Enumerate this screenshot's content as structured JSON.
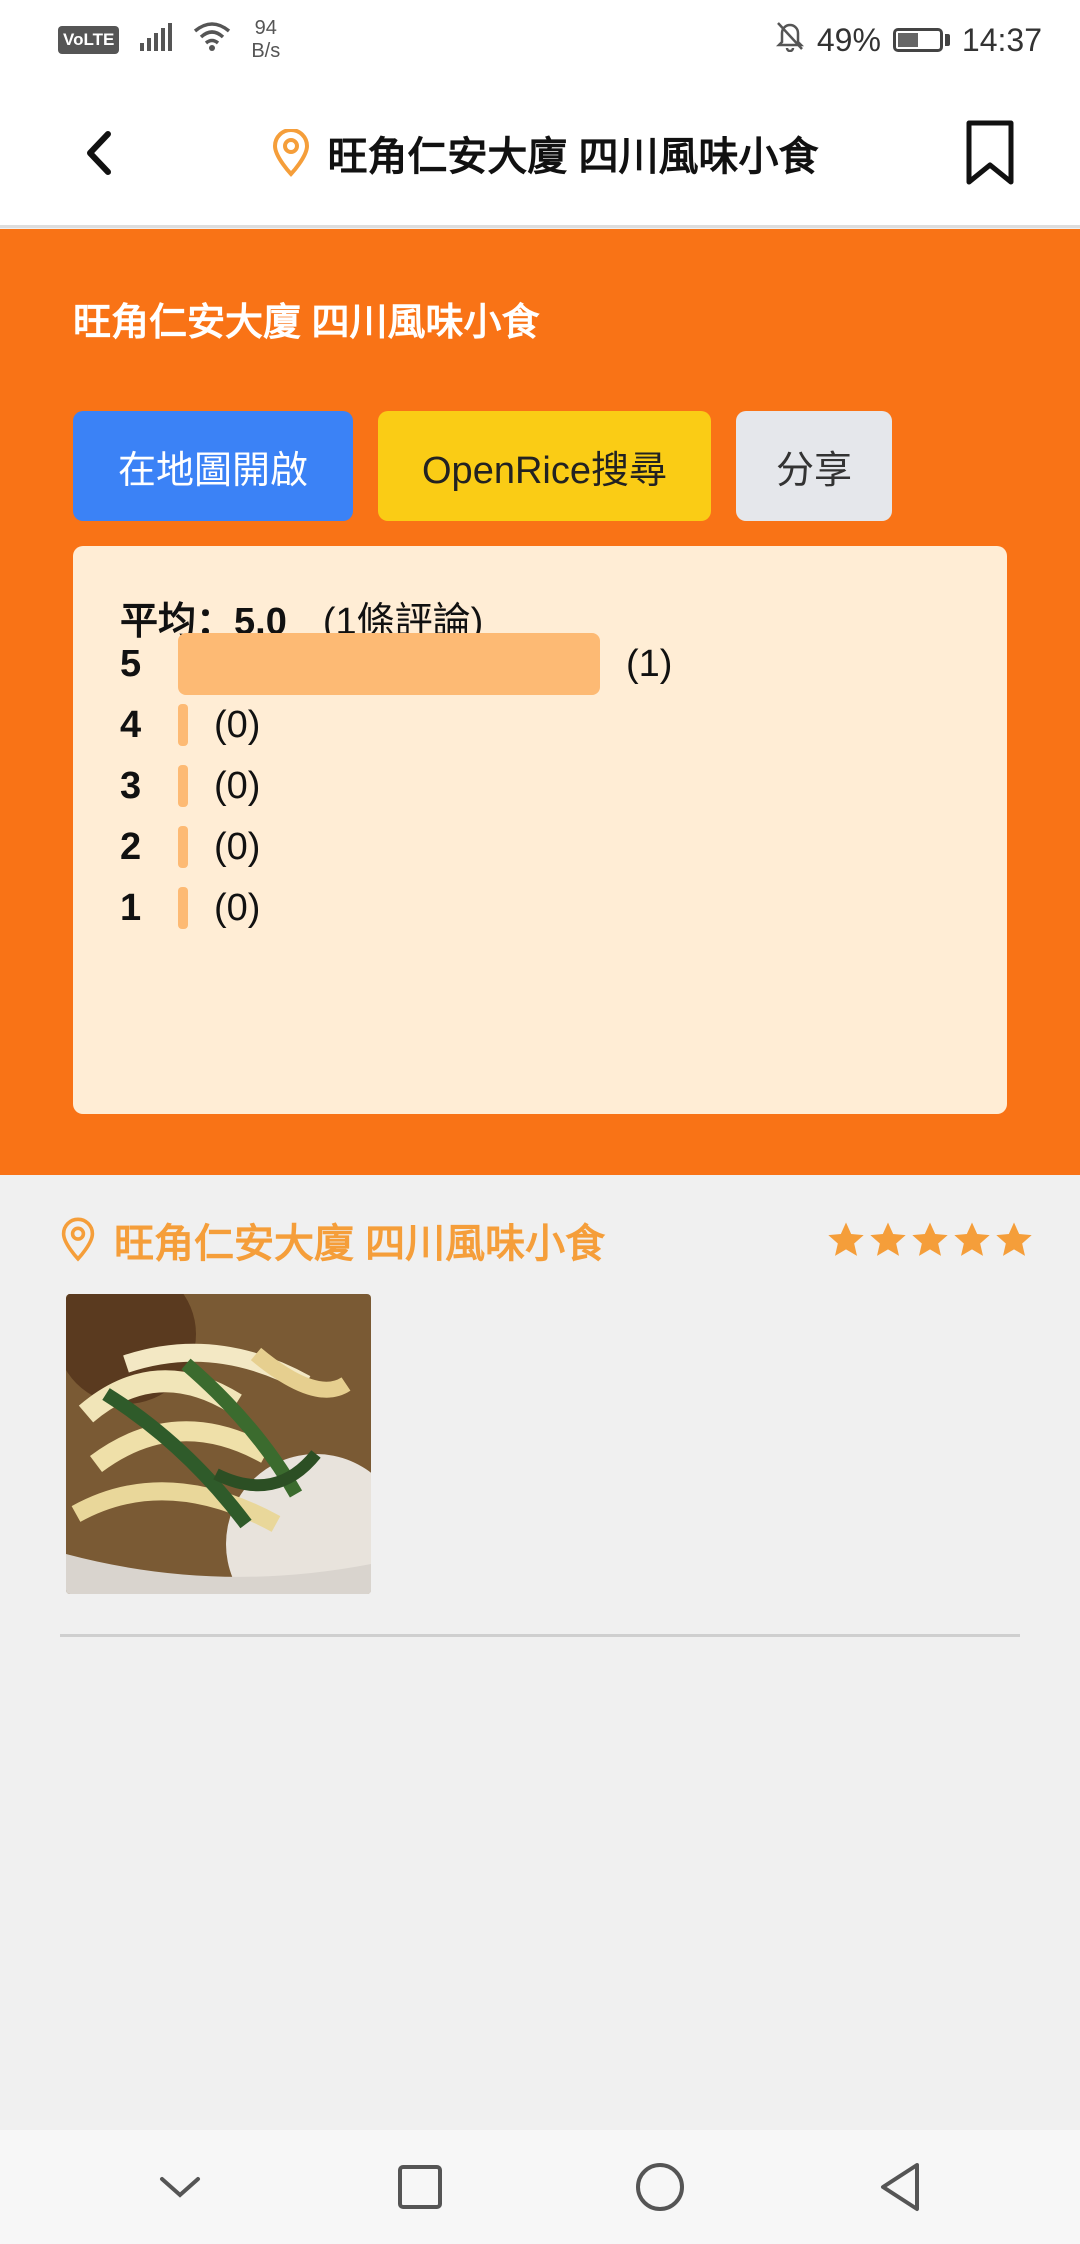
{
  "status_bar": {
    "volte": "VoLTE",
    "net_speed_value": "94",
    "net_speed_unit": "B/s",
    "battery": "49%",
    "time": "14:37"
  },
  "app_bar": {
    "title": "旺角仁安大廈 四川風味小食"
  },
  "header": {
    "place_name": "旺角仁安大廈 四川風味小食",
    "buttons": {
      "map": "在地圖開啟",
      "openrice": "OpenRice搜尋",
      "share": "分享"
    },
    "ratings": {
      "average_label": "平均：5.0",
      "review_count": "(1條評論)",
      "rows": [
        {
          "level": "5",
          "count": "(1)",
          "fraction": 1.0
        },
        {
          "level": "4",
          "count": "(0)",
          "fraction": 0
        },
        {
          "level": "3",
          "count": "(0)",
          "fraction": 0
        },
        {
          "level": "2",
          "count": "(0)",
          "fraction": 0
        },
        {
          "level": "1",
          "count": "(0)",
          "fraction": 0
        }
      ]
    }
  },
  "reviews": [
    {
      "place_name": "旺角仁安大廈 四川風味小食",
      "stars": 5
    }
  ],
  "colors": {
    "brand_orange": "#f97316",
    "map_button": "#3b82f6",
    "openrice_button": "#facc15",
    "share_button": "#e5e7eb",
    "rating_panel": "#ffedd5",
    "rating_bar": "#fdba74",
    "star": "#f59e3a"
  },
  "icons": {
    "back": "chevron-left-icon",
    "pin": "map-pin-icon",
    "bookmark": "bookmark-icon",
    "star": "star-icon"
  }
}
